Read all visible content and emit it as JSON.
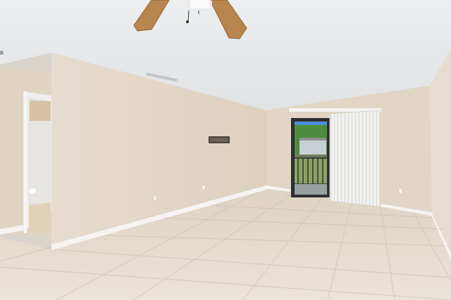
{
  "scene": {
    "subject": "empty-room-interior",
    "colors": {
      "ceiling": "#e6e8ea",
      "wall_light": "#e3d7c8",
      "wall_shadow": "#d6c7b5",
      "floor": "#e5dccd",
      "baseboard": "#f4f2ee",
      "trim": "#f2f0ec",
      "fan_blade": "#b9854f",
      "sky": "#4f8fd8",
      "foliage": "#3f7a35"
    }
  }
}
